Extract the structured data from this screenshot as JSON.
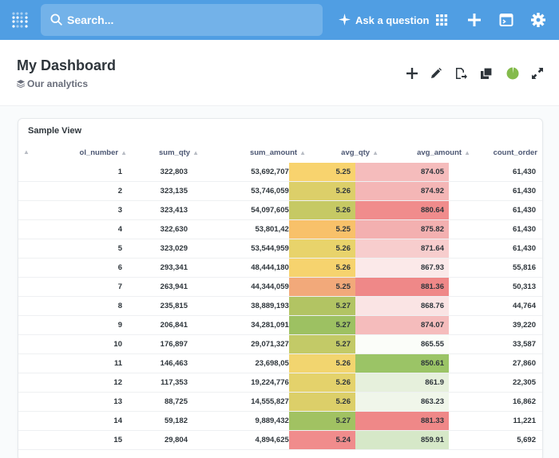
{
  "topbar": {
    "search_placeholder": "Search...",
    "ask_label": "Ask a question",
    "bg_color": "#509ee3"
  },
  "dashboard": {
    "title": "My Dashboard",
    "collection": "Our analytics",
    "status_color": "#84bb4c"
  },
  "card": {
    "title": "Sample View",
    "columns": [
      "ol_number",
      "sum_qty",
      "sum_amount",
      "avg_qty",
      "avg_amount",
      "count_order"
    ],
    "rows": [
      {
        "ol_number": "1",
        "sum_qty": "322,803",
        "sum_amount": "53,692,707.71",
        "avg_qty": "5.25",
        "avg_amount": "874.05",
        "count_order": "61,430",
        "avg_qty_color": "#f8d36e",
        "avg_amount_color": "#f5bcbc"
      },
      {
        "ol_number": "2",
        "sum_qty": "323,135",
        "sum_amount": "53,746,059.81",
        "avg_qty": "5.26",
        "avg_amount": "874.92",
        "count_order": "61,430",
        "avg_qty_color": "#dccf69",
        "avg_amount_color": "#f4b6b6"
      },
      {
        "ol_number": "3",
        "sum_qty": "323,413",
        "sum_amount": "54,097,605.53",
        "avg_qty": "5.26",
        "avg_amount": "880.64",
        "count_order": "61,430",
        "avg_qty_color": "#c6c964",
        "avg_amount_color": "#f08c8c"
      },
      {
        "ol_number": "4",
        "sum_qty": "322,630",
        "sum_amount": "53,801,429.5",
        "avg_qty": "5.25",
        "avg_amount": "875.82",
        "count_order": "61,430",
        "avg_qty_color": "#f8c16a",
        "avg_amount_color": "#f3b0b0"
      },
      {
        "ol_number": "5",
        "sum_qty": "323,029",
        "sum_amount": "53,544,959.15",
        "avg_qty": "5.26",
        "avg_amount": "871.64",
        "count_order": "61,430",
        "avg_qty_color": "#e8d36b",
        "avg_amount_color": "#f7cdcd"
      },
      {
        "ol_number": "6",
        "sum_qty": "293,341",
        "sum_amount": "48,444,180.75",
        "avg_qty": "5.26",
        "avg_amount": "867.93",
        "count_order": "55,816",
        "avg_qty_color": "#f6d36e",
        "avg_amount_color": "#fbe9e9"
      },
      {
        "ol_number": "7",
        "sum_qty": "263,941",
        "sum_amount": "44,344,059.92",
        "avg_qty": "5.25",
        "avg_amount": "881.36",
        "count_order": "50,313",
        "avg_qty_color": "#f2a97a",
        "avg_amount_color": "#ef8888"
      },
      {
        "ol_number": "8",
        "sum_qty": "235,815",
        "sum_amount": "38,889,193.03",
        "avg_qty": "5.27",
        "avg_amount": "868.76",
        "count_order": "44,764",
        "avg_qty_color": "#b2c463",
        "avg_amount_color": "#fae4e4"
      },
      {
        "ol_number": "9",
        "sum_qty": "206,841",
        "sum_amount": "34,281,091.94",
        "avg_qty": "5.27",
        "avg_amount": "874.07",
        "count_order": "39,220",
        "avg_qty_color": "#9dc162",
        "avg_amount_color": "#f5bcbc"
      },
      {
        "ol_number": "10",
        "sum_qty": "176,897",
        "sum_amount": "29,071,327.83",
        "avg_qty": "5.27",
        "avg_amount": "865.55",
        "count_order": "33,587",
        "avg_qty_color": "#c3ca67",
        "avg_amount_color": "#fbfdf9"
      },
      {
        "ol_number": "11",
        "sum_qty": "146,463",
        "sum_amount": "23,698,057.8",
        "avg_qty": "5.26",
        "avg_amount": "850.61",
        "count_order": "27,860",
        "avg_qty_color": "#f2d56f",
        "avg_amount_color": "#9bc466"
      },
      {
        "ol_number": "12",
        "sum_qty": "117,353",
        "sum_amount": "19,224,776.07",
        "avg_qty": "5.26",
        "avg_amount": "861.9",
        "count_order": "22,305",
        "avg_qty_color": "#e4d26b",
        "avg_amount_color": "#e6f0dc"
      },
      {
        "ol_number": "13",
        "sum_qty": "88,725",
        "sum_amount": "14,555,827.64",
        "avg_qty": "5.26",
        "avg_amount": "863.23",
        "count_order": "16,862",
        "avg_qty_color": "#dccf69",
        "avg_amount_color": "#f0f6ea"
      },
      {
        "ol_number": "14",
        "sum_qty": "59,182",
        "sum_amount": "9,889,432.03",
        "avg_qty": "5.27",
        "avg_amount": "881.33",
        "count_order": "11,221",
        "avg_qty_color": "#a1c262",
        "avg_amount_color": "#ef8888"
      },
      {
        "ol_number": "15",
        "sum_qty": "29,804",
        "sum_amount": "4,894,625.01",
        "avg_qty": "5.24",
        "avg_amount": "859.91",
        "count_order": "5,692",
        "avg_qty_color": "#f08c8c",
        "avg_amount_color": "#d6e8c8"
      }
    ]
  }
}
